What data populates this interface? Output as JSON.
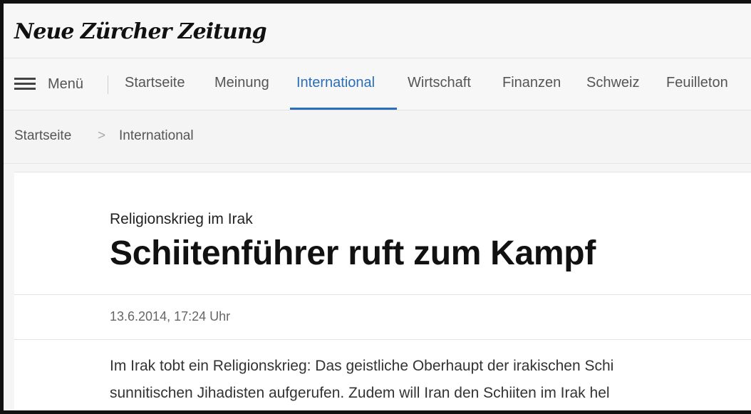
{
  "masthead": {
    "logo_text": "Neue Zürcher Zeitung"
  },
  "nav": {
    "menu_label": "Menü",
    "menu_icon": "hamburger-icon",
    "items": [
      {
        "label": "Startseite",
        "active": false
      },
      {
        "label": "Meinung",
        "active": false
      },
      {
        "label": "International",
        "active": true
      },
      {
        "label": "Wirtschaft",
        "active": false
      },
      {
        "label": "Finanzen",
        "active": false
      },
      {
        "label": "Schweiz",
        "active": false
      },
      {
        "label": "Feuilleton",
        "active": false
      }
    ]
  },
  "breadcrumb": {
    "items": [
      "Startseite",
      "International"
    ],
    "separator": ">"
  },
  "article": {
    "kicker": "Religionskrieg im Irak",
    "headline": "Schiitenführer ruft zum Kampf",
    "date": "13.6.2014, 17:24 Uhr",
    "lead_lines": [
      "Im Irak tobt ein Religionskrieg: Das geistliche Oberhaupt der irakischen Schi",
      "sunnitischen Jihadisten aufgerufen. Zudem will Iran den Schiiten im Irak hel"
    ]
  },
  "colors": {
    "accent": "#2a6ebb",
    "text": "#222222",
    "muted": "#555555"
  }
}
